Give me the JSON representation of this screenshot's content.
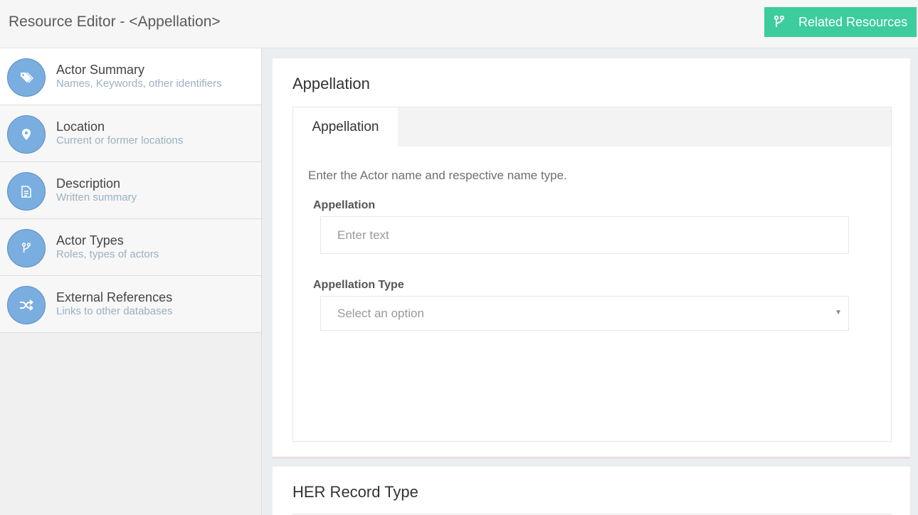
{
  "header": {
    "title": "Resource Editor - <Appellation>",
    "related_button": "Related Resources",
    "related_icon": "fork-icon",
    "accent_color": "#3ccc9d"
  },
  "sidebar": {
    "items": [
      {
        "title": "Actor Summary",
        "subtitle": "Names, Keywords, other identifiers",
        "icon": "tag-icon",
        "active": true
      },
      {
        "title": "Location",
        "subtitle": "Current or former locations",
        "icon": "map-marker-icon",
        "active": false
      },
      {
        "title": "Description",
        "subtitle": "Written summary",
        "icon": "document-icon",
        "active": false
      },
      {
        "title": "Actor Types",
        "subtitle": "Roles, types of actors",
        "icon": "fork-icon",
        "active": false
      },
      {
        "title": "External References",
        "subtitle": "Links to other databases",
        "icon": "shuffle-icon",
        "active": false
      }
    ],
    "icon_circle_color": "#7aaee0"
  },
  "main": {
    "card1": {
      "title": "Appellation",
      "tab_label": "Appellation",
      "instructions": "Enter the Actor name and respective name type.",
      "appellation_label": "Appellation",
      "appellation_placeholder": "Enter text",
      "appellation_value": "",
      "type_label": "Appellation Type",
      "type_value": "Select an option"
    },
    "card2": {
      "title": "HER Record Type"
    }
  }
}
